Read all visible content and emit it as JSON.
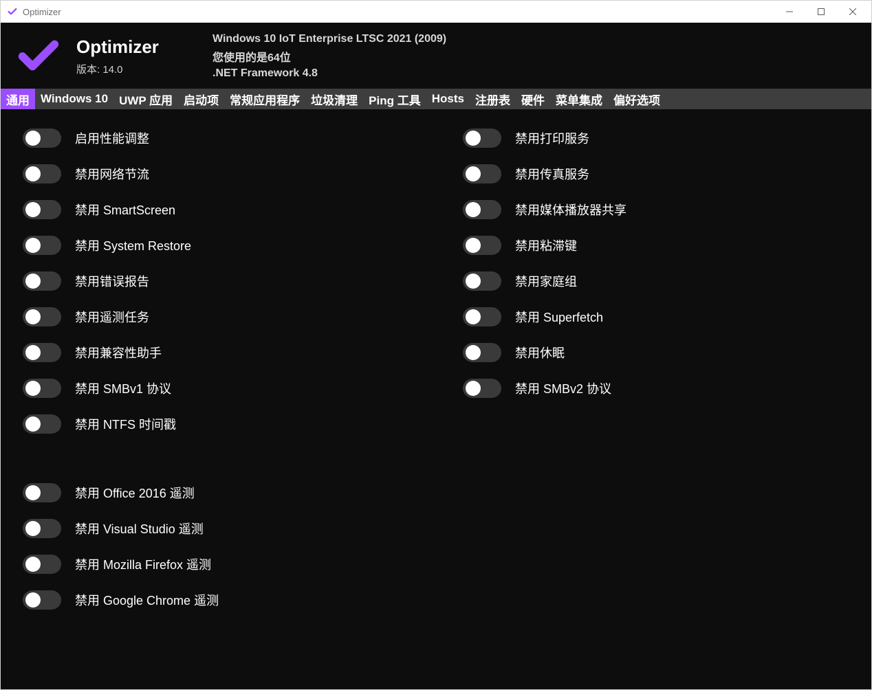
{
  "window": {
    "title": "Optimizer"
  },
  "header": {
    "app_name": "Optimizer",
    "version_label": "版本: 14.0",
    "os_line": "Windows 10 IoT Enterprise LTSC 2021 (2009)",
    "arch_line": "您使用的是64位",
    "dotnet_line": ".NET Framework 4.8"
  },
  "tabs": {
    "t0": "通用",
    "t1": "Windows 10",
    "t2": "UWP 应用",
    "t3": "启动项",
    "t4": "常规应用程序",
    "t5": "垃圾清理",
    "t6": "Ping 工具",
    "t7": "Hosts",
    "t8": "注册表",
    "t9": "硬件",
    "t10": "菜单集成",
    "t11": "偏好选项"
  },
  "left": {
    "o0": "启用性能调整",
    "o1": "禁用网络节流",
    "o2": "禁用 SmartScreen",
    "o3": "禁用 System Restore",
    "o4": "禁用错误报告",
    "o5": "禁用遥测任务",
    "o6": "禁用兼容性助手",
    "o7": "禁用 SMBv1 协议",
    "o8": "禁用 NTFS 时间戳",
    "o9": "禁用 Office 2016 遥测",
    "o10": "禁用 Visual Studio 遥测",
    "o11": "禁用 Mozilla Firefox 遥测",
    "o12": "禁用 Google Chrome 遥测"
  },
  "right": {
    "r0": "禁用打印服务",
    "r1": "禁用传真服务",
    "r2": "禁用媒体播放器共享",
    "r3": "禁用粘滞键",
    "r4": "禁用家庭组",
    "r5": "禁用 Superfetch",
    "r6": "禁用休眠",
    "r7": "禁用 SMBv2 协议"
  },
  "colors": {
    "accent": "#9b4dff"
  }
}
